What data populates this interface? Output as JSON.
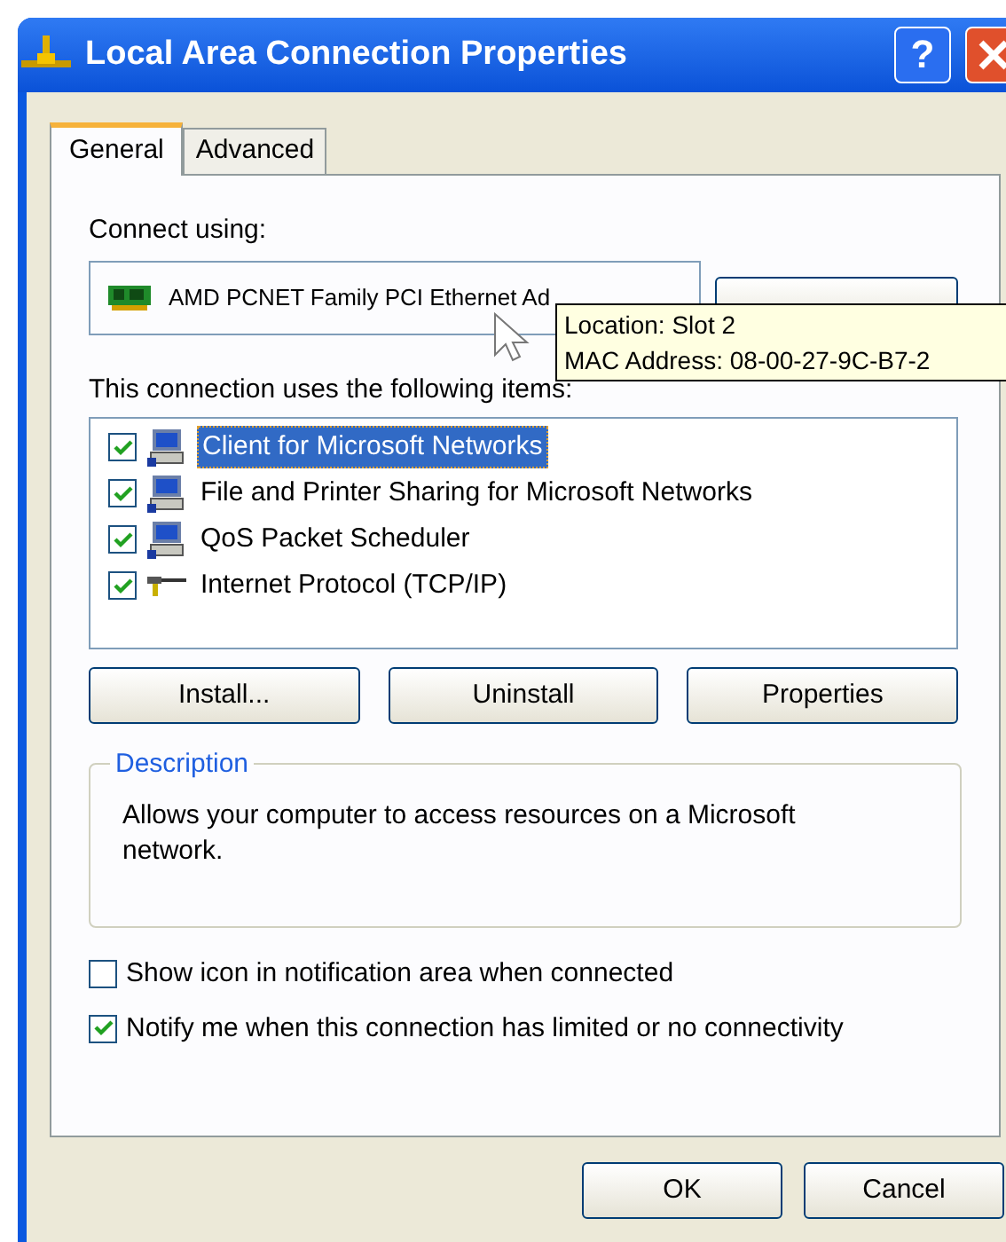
{
  "window": {
    "title": "Local Area Connection Properties",
    "help_button": "?"
  },
  "tabs": [
    {
      "label": "General",
      "selected": true
    },
    {
      "label": "Advanced",
      "selected": false
    }
  ],
  "connect_using": {
    "label": "Connect using:",
    "adapter": "AMD PCNET Family PCI Ethernet Ad"
  },
  "tooltip": {
    "lines": [
      "Location: Slot 2",
      "MAC Address: 08-00-27-9C-B7-2"
    ]
  },
  "components": {
    "label": "This connection uses the following items:",
    "items": [
      {
        "name": "Client for Microsoft Networks",
        "checked": true,
        "selected": true,
        "kind": "computer"
      },
      {
        "name": "File and Printer Sharing for Microsoft Networks",
        "checked": true,
        "selected": false,
        "kind": "computer"
      },
      {
        "name": "QoS Packet Scheduler",
        "checked": true,
        "selected": false,
        "kind": "computer"
      },
      {
        "name": "Internet Protocol (TCP/IP)",
        "checked": true,
        "selected": false,
        "kind": "protocol"
      }
    ]
  },
  "item_buttons": [
    "Install...",
    "Uninstall",
    "Properties"
  ],
  "description": {
    "title": "Description",
    "text": "Allows your computer to access resources on a Microsoft network."
  },
  "options": [
    {
      "label": "Show icon in notification area when connected",
      "checked": false
    },
    {
      "label": "Notify me when this connection has limited or no connectivity",
      "checked": true
    }
  ],
  "buttons": [
    "OK",
    "Cancel"
  ]
}
